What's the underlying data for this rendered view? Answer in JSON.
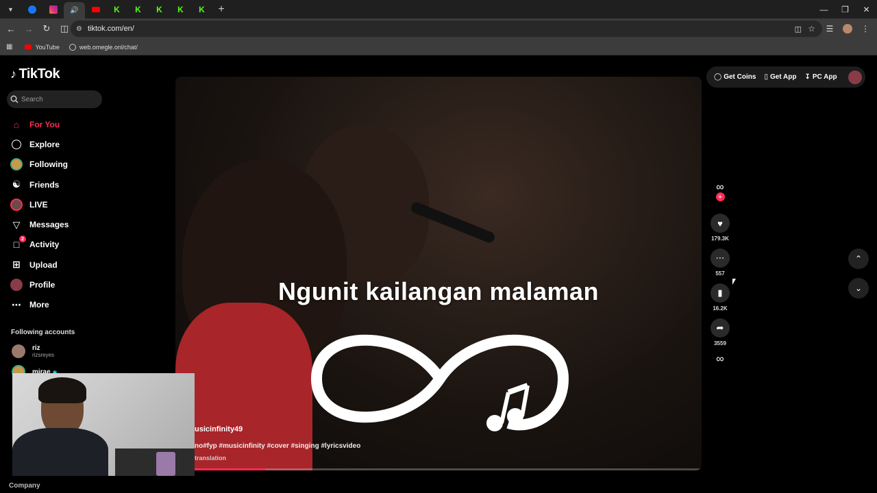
{
  "browser": {
    "tabs": [
      {
        "icon": "chevron-down-icon"
      },
      {
        "icon": "facebook-icon",
        "color": "#1877f2"
      },
      {
        "icon": "instagram-icon",
        "color": "#e1306c"
      },
      {
        "icon": "speaker-icon",
        "active": true
      },
      {
        "icon": "youtube-icon",
        "color": "#ff0000"
      },
      {
        "icon": "kick-icon",
        "color": "#53fc18"
      },
      {
        "icon": "kick-icon",
        "color": "#53fc18"
      },
      {
        "icon": "kick-icon",
        "color": "#53fc18"
      },
      {
        "icon": "kick-icon",
        "color": "#53fc18"
      },
      {
        "icon": "kick-icon",
        "color": "#53fc18"
      }
    ],
    "new_tab": "+",
    "url": "tiktok.com/en/",
    "bookmarks": [
      {
        "label": "YouTube",
        "icon": "youtube-icon"
      },
      {
        "label": "web.omegle.onl/chat/",
        "icon": "globe-icon"
      }
    ]
  },
  "tiktok": {
    "logo": "TikTok",
    "search_placeholder": "Search",
    "nav": [
      {
        "label": "For You",
        "icon": "home-icon",
        "active": true
      },
      {
        "label": "Explore",
        "icon": "compass-icon"
      },
      {
        "label": "Following",
        "icon": "following-avatar-icon"
      },
      {
        "label": "Friends",
        "icon": "friends-icon"
      },
      {
        "label": "LIVE",
        "icon": "live-avatar-icon"
      },
      {
        "label": "Messages",
        "icon": "send-icon"
      },
      {
        "label": "Activity",
        "icon": "inbox-icon",
        "badge": "2"
      },
      {
        "label": "Upload",
        "icon": "plus-square-icon"
      },
      {
        "label": "Profile",
        "icon": "profile-avatar-icon"
      },
      {
        "label": "More",
        "icon": "more-icon"
      }
    ],
    "following_header": "Following accounts",
    "following": [
      {
        "name": "riz",
        "username": "rizsreyes"
      },
      {
        "name": "mirae",
        "username": ""
      }
    ],
    "company": "Company",
    "topbar": {
      "get_coins": "Get Coins",
      "get_app": "Get App",
      "pc_app": "PC App"
    },
    "video": {
      "caption": "Ngunit kailangan malaman",
      "author": "musicinfinity49",
      "author_visible": "usicinfinity49",
      "description": "no#fyp #musicinfinity #cover #singing #lyricsvideo",
      "translation": "translation",
      "progress": 0.17
    },
    "actions": {
      "likes": "179.3K",
      "comments": "557",
      "saves": "16.2K",
      "shares": "3559"
    }
  },
  "colors": {
    "accent": "#fe2c55",
    "background": "#000000"
  }
}
